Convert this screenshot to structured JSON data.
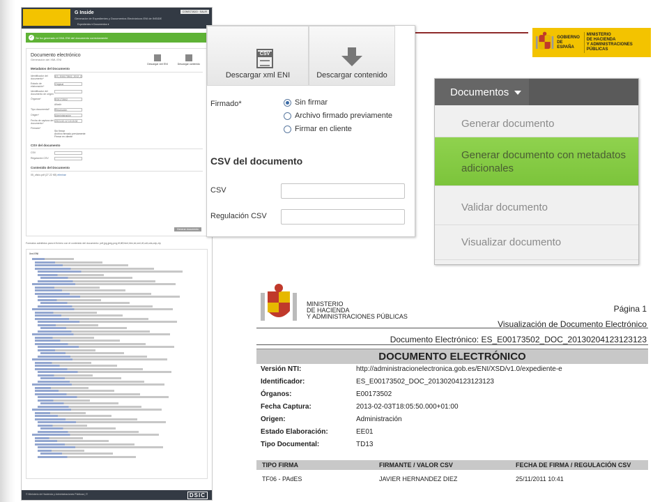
{
  "left_app": {
    "app_name": "G Inside",
    "app_subtitle": "Generador de Expedientes y Documentos Electrónicos ENI de INSIDE",
    "user_label": "CONECTADO · SALIR",
    "nav": "Expedientes ▾   Documentos ▾",
    "success_message": "Se ha generado el XML ENI del documento correctamente",
    "doc_title": "Documento electrónico",
    "doc_subtitle": "Generación del XML ENI",
    "btn_xml": "Descargar xml ENI",
    "btn_content": "Descargar contenido",
    "meta_heading": "Metadatos del Documento",
    "fields": [
      {
        "label": "Identificador del documento*",
        "value": "ES_E00173502_2012_D"
      },
      {
        "label": "Estado de elaboración*",
        "value": "Original"
      },
      {
        "label": "Identificador del documento de origen",
        "value": ""
      },
      {
        "label": "Órganos*",
        "value": "E00173502"
      },
      {
        "label": "Tipo documental*",
        "value": "Resolución"
      },
      {
        "label": "Origen*",
        "value": "Administración"
      },
      {
        "label": "Fecha de captura del documento*",
        "value": "2013-02-12 10:15:32"
      }
    ],
    "add_button": "Añadir",
    "firma_label": "Firmado*",
    "firma_options": [
      "Sin firmar",
      "Archivo firmado previamente",
      "Firmar en cliente"
    ],
    "csv_heading": "CSV del documento",
    "csv_label": "CSV",
    "csv_reg_label": "Regulación CSV",
    "content_heading": "Contenido del Documento",
    "file_name": "05_oficio.pdf (27.22 KB)",
    "file_action": "eliminar",
    "generate_button": "Generar documento",
    "formats_note": "Formatos admitidos para el fichero con el contenido del documento: pdf,jpg,jpeg,png,tif,tiff,html,htm,txt,xml,rtf,odt,ods,odp,zip",
    "xml_heading": "Xml ENI",
    "footer_text": "© Ministerio de Hacienda y Administraciones Públicas | ©",
    "footer_logo": "DSIC"
  },
  "gov_logo": {
    "left": [
      "GOBIERNO",
      "DE ESPAÑA"
    ],
    "right": [
      "MINISTERIO",
      "DE HACIENDA",
      "Y ADMINISTRACIONES PÚBLICAS"
    ]
  },
  "form": {
    "download_xml": "Descargar xml ENI",
    "download_content": "Descargar contenido",
    "csv_tag": "CSV",
    "firmado_label": "Firmado*",
    "radio_options": [
      {
        "label": "Sin firmar",
        "selected": true
      },
      {
        "label": "Archivo firmado previamente",
        "selected": false
      },
      {
        "label": "Firmar en cliente",
        "selected": false
      }
    ],
    "csv_title": "CSV del documento",
    "csv_label": "CSV",
    "regulacion_label": "Regulación CSV"
  },
  "menu": {
    "title": "Documentos",
    "items": [
      {
        "label": "Generar documento",
        "highlighted": false
      },
      {
        "label": "Generar documento con metadatos adicionales",
        "highlighted": true
      },
      {
        "label": "Validar documento",
        "highlighted": false
      },
      {
        "label": "Visualizar documento",
        "highlighted": false
      }
    ]
  },
  "pdf": {
    "ministry": [
      "MINISTERIO",
      "DE HACIENDA",
      "Y ADMINISTRACIONES PÚBLICAS"
    ],
    "page": "Página 1",
    "view_title": "Visualización de Documento Electrónico",
    "doc_id_line": "Documento Electrónico: ES_E00173502_DOC_20130204123123123",
    "banner": "DOCUMENTO ELECTRÓNICO",
    "rows": [
      {
        "key": "Versión NTI:",
        "value": "http://administracionelectronica.gob.es/ENI/XSD/v1.0/expediente-e"
      },
      {
        "key": "Identificador:",
        "value": "ES_E00173502_DOC_20130204123123123"
      },
      {
        "key": "Órganos:",
        "value": "E00173502"
      },
      {
        "key": "Fecha Captura:",
        "value": "2013-02-03T18:05:50.000+01:00"
      },
      {
        "key": "Origen:",
        "value": "Administración"
      },
      {
        "key": "Estado Elaboración:",
        "value": "EE01"
      },
      {
        "key": "Tipo Documental:",
        "value": "TD13"
      }
    ],
    "table_headers": [
      "TIPO FIRMA",
      "FIRMANTE / VALOR CSV",
      "FECHA DE FIRMA / REGULACIÓN CSV"
    ],
    "table_row": [
      "TF06 - PAdES",
      "JAVIER HERNANDEZ DIEZ",
      "25/11/2011 10:41"
    ]
  }
}
